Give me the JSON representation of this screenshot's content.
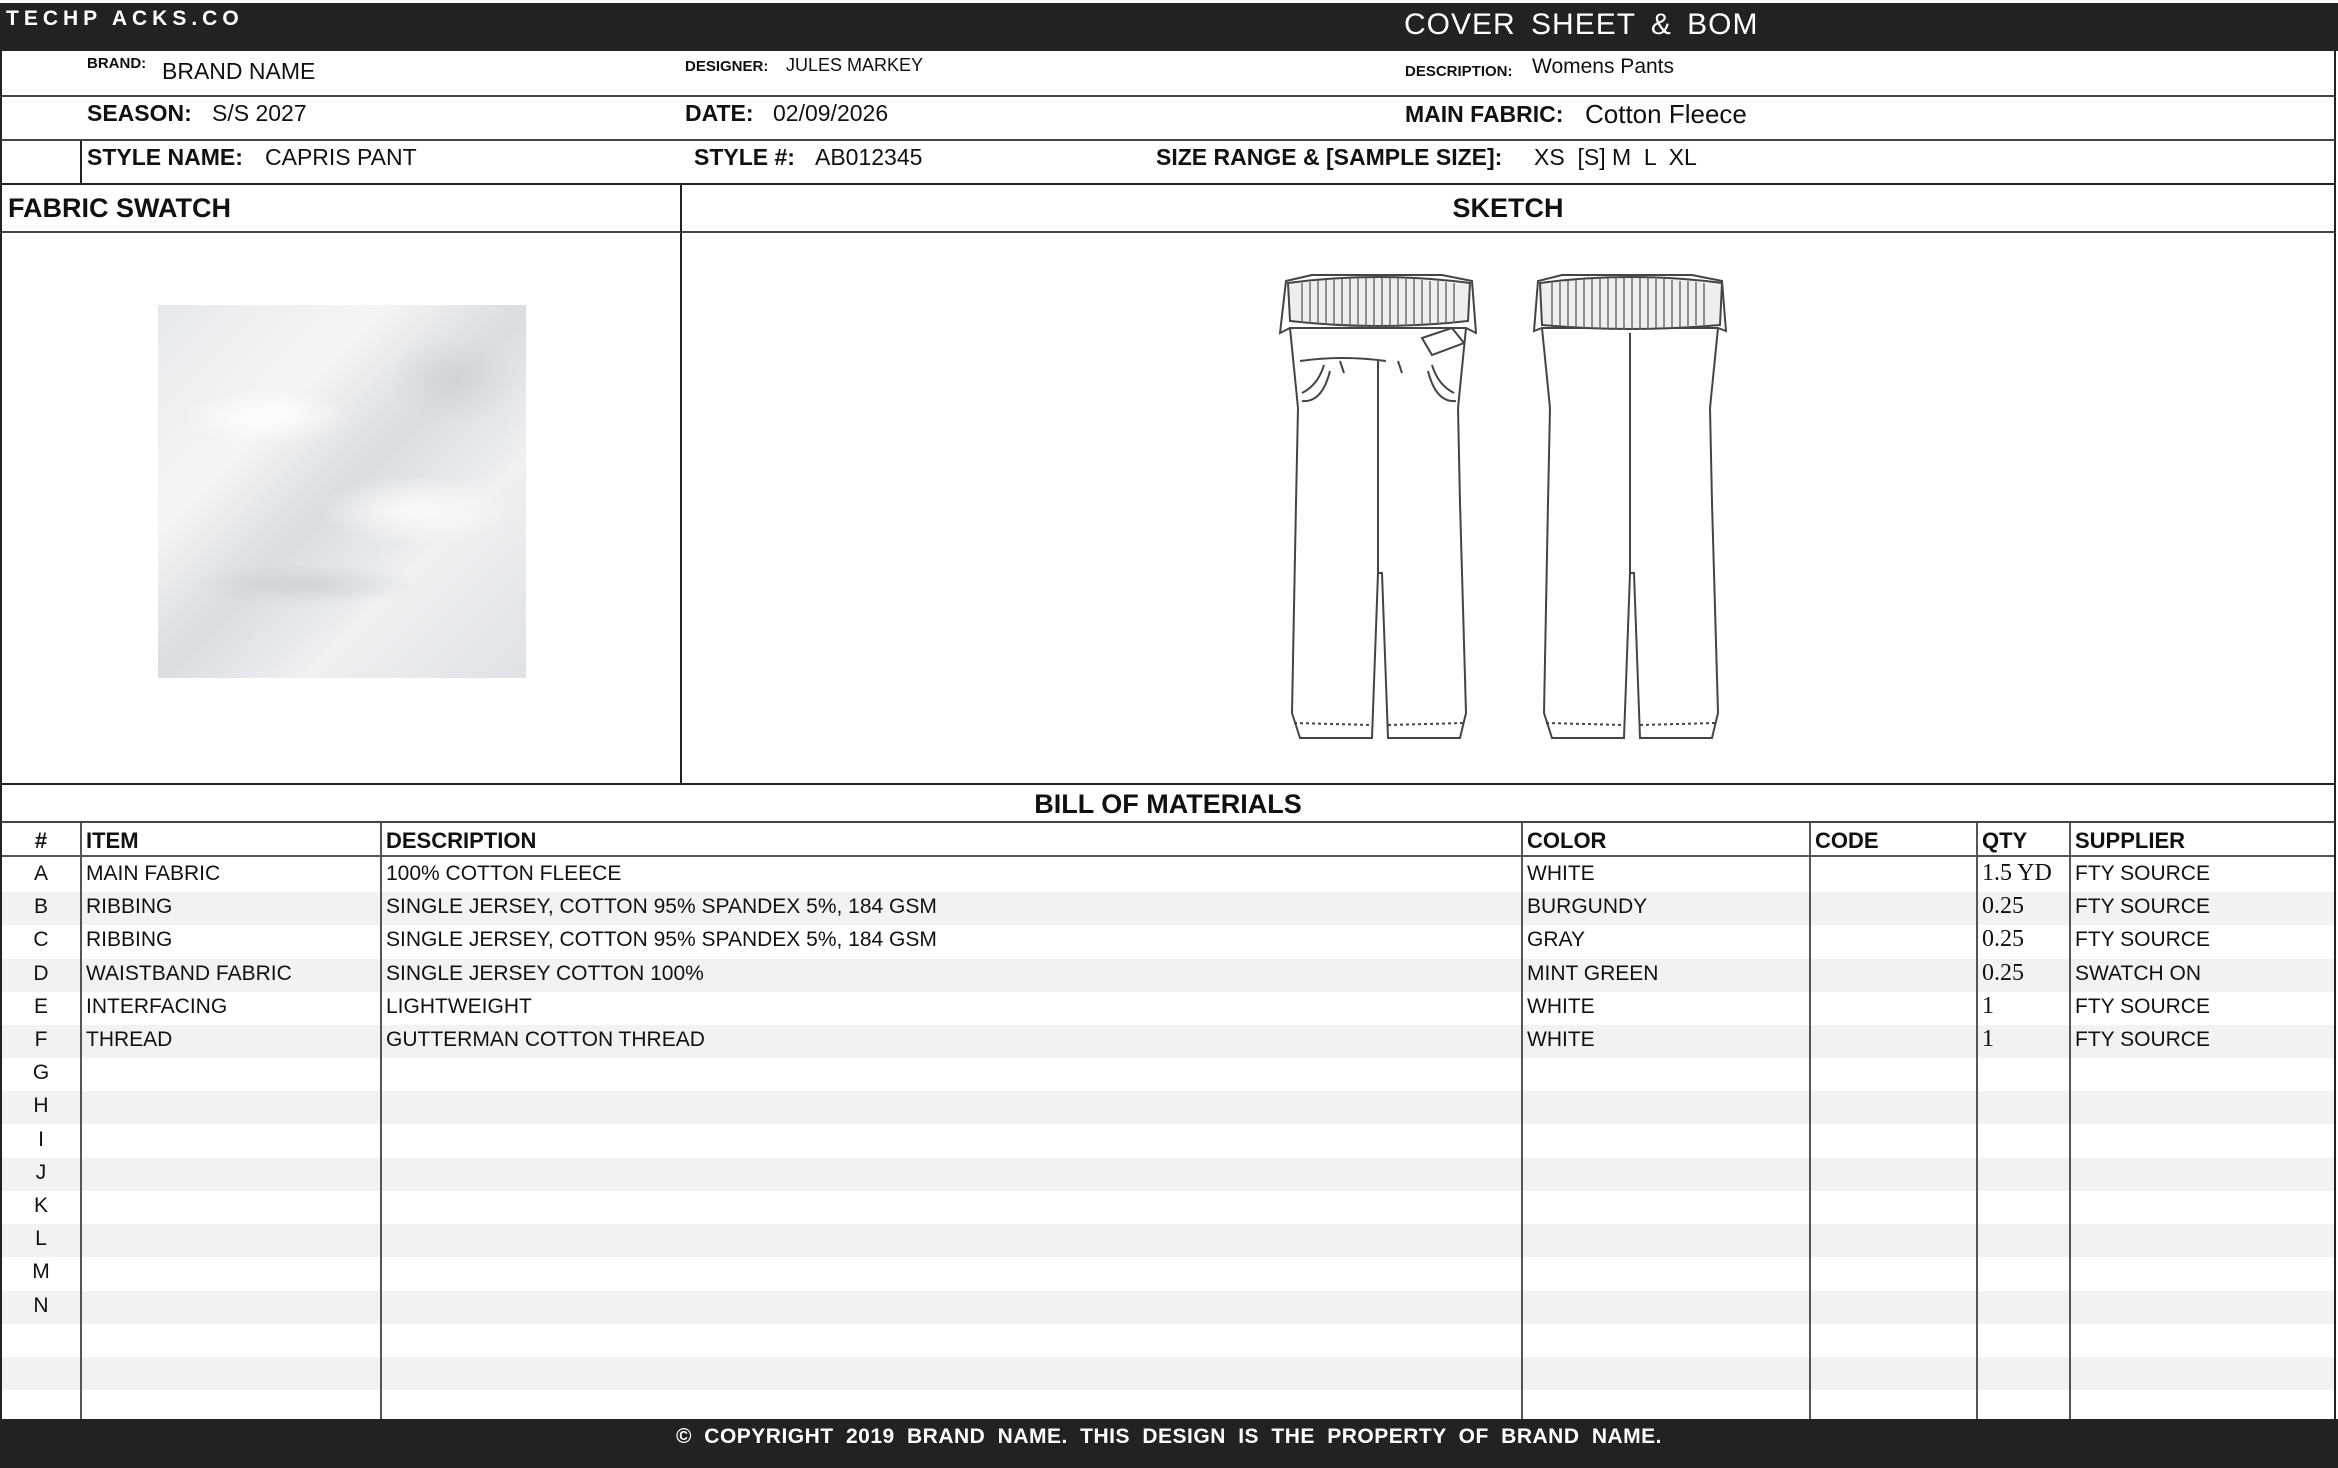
{
  "header": {
    "brand_mark": "TECHP ACKS.CO",
    "sheet_title": "COVER SHEET & BOM"
  },
  "info": {
    "brand_label": "BRAND:",
    "brand_value": "BRAND NAME",
    "designer_label": "DESIGNER:",
    "designer_value": "JULES MARKEY",
    "description_label": "DESCRIPTION:",
    "description_value": "Womens Pants",
    "season_label": "SEASON:",
    "season_value": "S/S 2027",
    "date_label": "DATE:",
    "date_value": "02/09/2026",
    "main_fabric_label": "MAIN FABRIC:",
    "main_fabric_value": "Cotton Fleece",
    "style_name_label": "STYLE NAME:",
    "style_name_value": "CAPRIS PANT",
    "style_num_label": "STYLE #:",
    "style_num_value": "AB012345",
    "size_range_label": "SIZE RANGE & [SAMPLE SIZE]:",
    "size_range_value": "XS  [S] M  L  XL"
  },
  "panels": {
    "fabric_swatch_title": "FABRIC SWATCH",
    "sketch_title": "SKETCH"
  },
  "bom": {
    "title": "BILL OF MATERIALS",
    "headers": {
      "num": "#",
      "item": "ITEM",
      "description": "DESCRIPTION",
      "color": "COLOR",
      "code": "CODE",
      "qty": "QTY",
      "supplier": "SUPPLIER"
    },
    "rows": [
      {
        "id": "A",
        "item": "MAIN FABRIC",
        "description": "100% COTTON FLEECE",
        "color": "WHITE",
        "code": "",
        "qty": "1.5 YD",
        "supplier": "FTY SOURCE"
      },
      {
        "id": "B",
        "item": "RIBBING",
        "description": "SINGLE JERSEY, COTTON 95% SPANDEX 5%, 184 GSM",
        "color": "BURGUNDY",
        "code": "",
        "qty": "0.25",
        "supplier": "FTY SOURCE"
      },
      {
        "id": "C",
        "item": "RIBBING",
        "description": "SINGLE JERSEY, COTTON 95% SPANDEX 5%, 184 GSM",
        "color": "GRAY",
        "code": "",
        "qty": "0.25",
        "supplier": "FTY SOURCE"
      },
      {
        "id": "D",
        "item": "WAISTBAND FABRIC",
        "description": "SINGLE JERSEY COTTON 100%",
        "color": "MINT GREEN",
        "code": "",
        "qty": "0.25",
        "supplier": "SWATCH ON"
      },
      {
        "id": "E",
        "item": "INTERFACING",
        "description": "LIGHTWEIGHT",
        "color": "WHITE",
        "code": "",
        "qty": "1",
        "supplier": "FTY SOURCE"
      },
      {
        "id": "F",
        "item": "THREAD",
        "description": "GUTTERMAN COTTON THREAD",
        "color": "WHITE",
        "code": "",
        "qty": "1",
        "supplier": "FTY SOURCE"
      },
      {
        "id": "G",
        "item": "",
        "description": "",
        "color": "",
        "code": "",
        "qty": "",
        "supplier": ""
      },
      {
        "id": "H",
        "item": "",
        "description": "",
        "color": "",
        "code": "",
        "qty": "",
        "supplier": ""
      },
      {
        "id": "I",
        "item": "",
        "description": "",
        "color": "",
        "code": "",
        "qty": "",
        "supplier": ""
      },
      {
        "id": "J",
        "item": "",
        "description": "",
        "color": "",
        "code": "",
        "qty": "",
        "supplier": ""
      },
      {
        "id": "K",
        "item": "",
        "description": "",
        "color": "",
        "code": "",
        "qty": "",
        "supplier": ""
      },
      {
        "id": "L",
        "item": "",
        "description": "",
        "color": "",
        "code": "",
        "qty": "",
        "supplier": ""
      },
      {
        "id": "M",
        "item": "",
        "description": "",
        "color": "",
        "code": "",
        "qty": "",
        "supplier": ""
      },
      {
        "id": "N",
        "item": "",
        "description": "",
        "color": "",
        "code": "",
        "qty": "",
        "supplier": ""
      },
      {
        "id": "",
        "item": "",
        "description": "",
        "color": "",
        "code": "",
        "qty": "",
        "supplier": ""
      },
      {
        "id": "",
        "item": "",
        "description": "",
        "color": "",
        "code": "",
        "qty": "",
        "supplier": ""
      },
      {
        "id": "",
        "item": "",
        "description": "",
        "color": "",
        "code": "",
        "qty": "",
        "supplier": ""
      }
    ]
  },
  "footer": {
    "copyright": "© COPYRIGHT 2019 BRAND NAME. THIS DESIGN IS THE PROPERTY OF BRAND NAME."
  },
  "colors": {
    "bar_background": "#222222",
    "row_alt": "#f2f2f2"
  }
}
